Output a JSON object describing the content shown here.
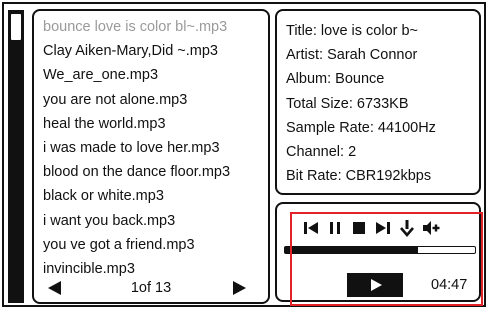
{
  "playlist": {
    "items": [
      "bounce love is color bl~.mp3",
      "Clay Aiken-Mary,Did ~.mp3",
      "We_are_one.mp3",
      "you are not alone.mp3",
      "heal the world.mp3",
      "i was made to love her.mp3",
      "blood on the dance floor.mp3",
      "black or white.mp3",
      "i want you back.mp3",
      "you ve got a friend.mp3",
      "invincible.mp3"
    ],
    "selected_index": 0,
    "page_label": "1of 13"
  },
  "info": {
    "title": "Title: love is color b~",
    "artist": "Artist: Sarah Connor",
    "album": "Album: Bounce",
    "total_size": "Total Size: 6733KB",
    "sample_rate": "Sample Rate: 44100Hz",
    "channel": "Channel: 2",
    "bit_rate": "Bit Rate: CBR192kbps"
  },
  "player": {
    "controls": [
      "prev-track-icon",
      "pause-icon",
      "stop-icon",
      "next-track-icon",
      "download-arrow-icon",
      "volume-up-icon"
    ],
    "progress": 0.7,
    "time": "04:47"
  },
  "colors": {
    "ink": "#111111",
    "selected_text": "#9a9a9a",
    "highlight": "#e32228"
  }
}
